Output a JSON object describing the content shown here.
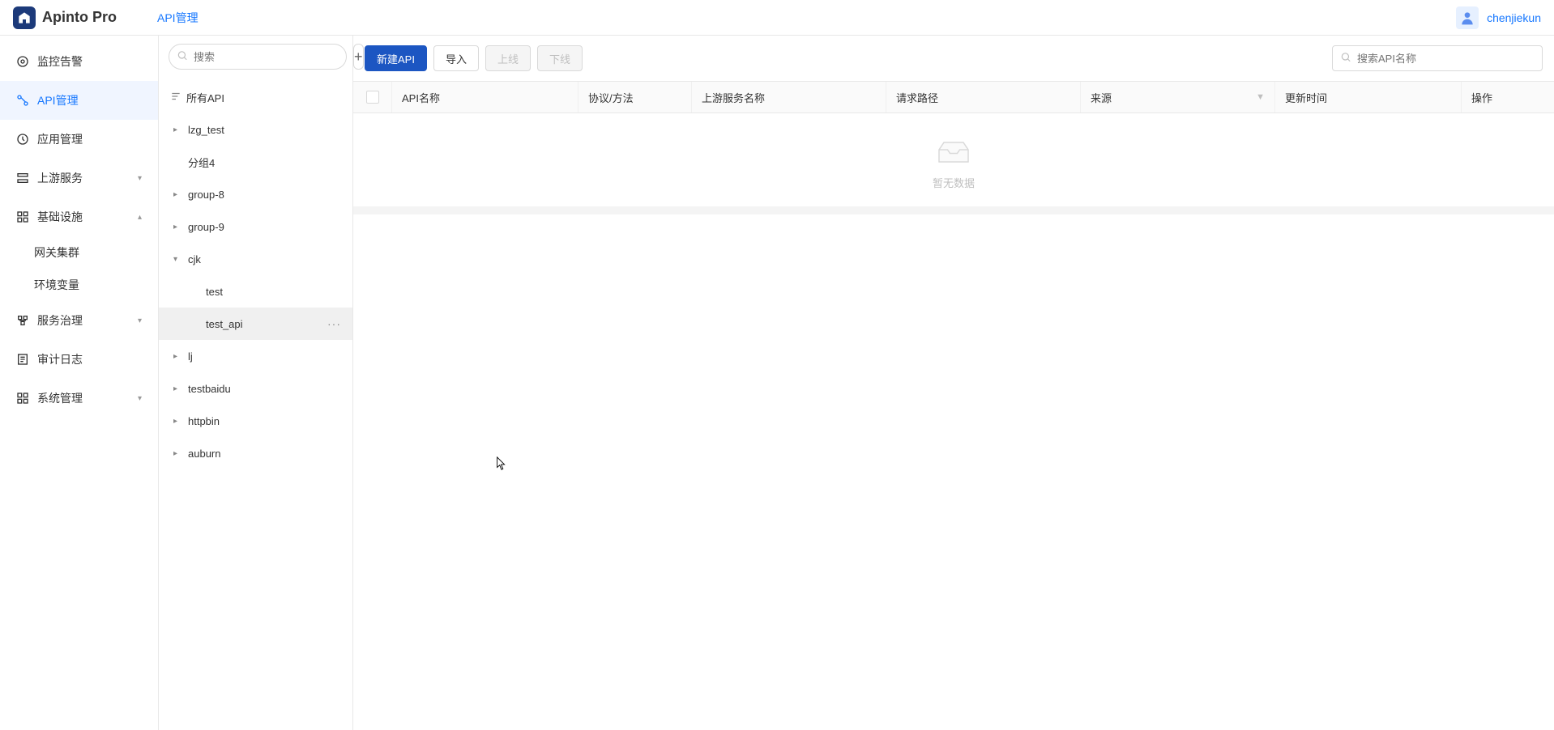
{
  "header": {
    "logo_text": "Apinto Pro",
    "breadcrumb": "API管理",
    "username": "chenjiekun"
  },
  "sidebar": {
    "items": [
      {
        "label": "监控告警",
        "icon": "monitor"
      },
      {
        "label": "API管理",
        "icon": "api",
        "active": true
      },
      {
        "label": "应用管理",
        "icon": "app"
      },
      {
        "label": "上游服务",
        "icon": "upstream",
        "expandable": true,
        "expanded": false
      },
      {
        "label": "基础设施",
        "icon": "infra",
        "expandable": true,
        "expanded": true
      },
      {
        "label": "服务治理",
        "icon": "governance",
        "expandable": true,
        "expanded": false
      },
      {
        "label": "审计日志",
        "icon": "audit"
      },
      {
        "label": "系统管理",
        "icon": "settings",
        "expandable": true,
        "expanded": false
      }
    ],
    "infra_children": [
      {
        "label": "网关集群"
      },
      {
        "label": "环境变量"
      }
    ]
  },
  "tree": {
    "search_placeholder": "搜索",
    "root": "所有API",
    "items": [
      {
        "label": "lzg_test",
        "level": 1,
        "arrow": "right"
      },
      {
        "label": "分组4",
        "level": 1,
        "arrow": ""
      },
      {
        "label": "group-8",
        "level": 1,
        "arrow": "right"
      },
      {
        "label": "group-9",
        "level": 1,
        "arrow": "right"
      },
      {
        "label": "cjk",
        "level": 1,
        "arrow": "down"
      },
      {
        "label": "test",
        "level": 2,
        "arrow": ""
      },
      {
        "label": "test_api",
        "level": 2,
        "arrow": "",
        "selected": true,
        "more": true
      },
      {
        "label": "lj",
        "level": 1,
        "arrow": "right"
      },
      {
        "label": "testbaidu",
        "level": 1,
        "arrow": "right"
      },
      {
        "label": "httpbin",
        "level": 1,
        "arrow": "right"
      },
      {
        "label": "auburn",
        "level": 1,
        "arrow": "right"
      }
    ]
  },
  "toolbar": {
    "create_api": "新建API",
    "import": "导入",
    "online": "上线",
    "offline": "下线",
    "search_placeholder": "搜索API名称"
  },
  "table": {
    "columns": {
      "name": "API名称",
      "protocol": "协议/方法",
      "upstream": "上游服务名称",
      "path": "请求路径",
      "source": "来源",
      "update_time": "更新时间",
      "action": "操作"
    },
    "empty_text": "暂无数据"
  }
}
